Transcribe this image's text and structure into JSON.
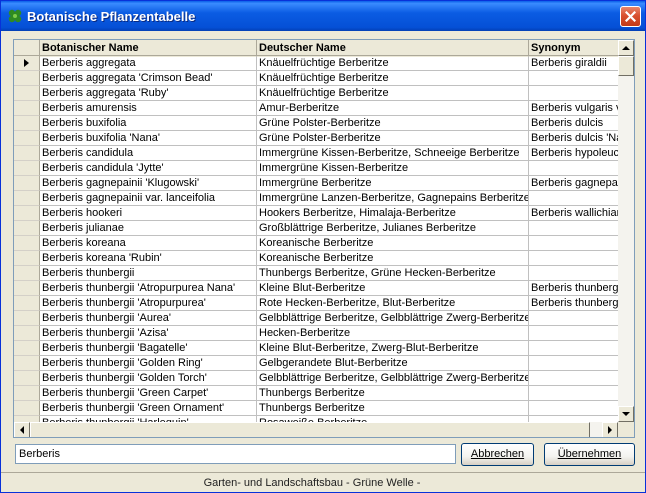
{
  "window": {
    "title": "Botanische Pflanzentabelle"
  },
  "table": {
    "columns": [
      "Botanischer Name",
      "Deutscher Name",
      "Synonym"
    ],
    "rows": [
      [
        "Berberis aggregata",
        "Knäuelfrüchtige Berberitze",
        "Berberis giraldii"
      ],
      [
        "Berberis aggregata 'Crimson Bead'",
        "Knäuelfrüchtige Berberitze",
        ""
      ],
      [
        "Berberis aggregata 'Ruby'",
        "Knäuelfrüchtige Berberitze",
        ""
      ],
      [
        "Berberis amurensis",
        "Amur-Berberitze",
        "Berberis vulgaris v"
      ],
      [
        "Berberis buxifolia",
        "Grüne Polster-Berberitze",
        "Berberis dulcis"
      ],
      [
        "Berberis buxifolia 'Nana'",
        "Grüne Polster-Berberitze",
        "Berberis dulcis 'Na"
      ],
      [
        "Berberis candidula",
        "Immergrüne Kissen-Berberitze, Schneeige Berberitze",
        "Berberis hypoleuca"
      ],
      [
        "Berberis candidula 'Jytte'",
        "Immergrüne Kissen-Berberitze",
        ""
      ],
      [
        "Berberis gagnepainii 'Klugowski'",
        "Immergrüne Berberitze",
        "Berberis gagnepain"
      ],
      [
        "Berberis gagnepainii var. lanceifolia",
        "Immergrüne Lanzen-Berberitze, Gagnepains Berberitze",
        ""
      ],
      [
        "Berberis hookeri",
        "Hookers Berberitze, Himalaja-Berberitze",
        "Berberis wallichian"
      ],
      [
        "Berberis julianae",
        "Großblättrige Berberitze, Julianes Berberitze",
        ""
      ],
      [
        "Berberis koreana",
        "Koreanische Berberitze",
        ""
      ],
      [
        "Berberis koreana 'Rubin'",
        "Koreanische Berberitze",
        ""
      ],
      [
        "Berberis thunbergii",
        "Thunbergs Berberitze, Grüne Hecken-Berberitze",
        ""
      ],
      [
        "Berberis thunbergii 'Atropurpurea Nana'",
        "Kleine Blut-Berberitze",
        "Berberis thunbergii"
      ],
      [
        "Berberis thunbergii 'Atropurpurea'",
        "Rote Hecken-Berberitze, Blut-Berberitze",
        "Berberis thunbergii"
      ],
      [
        "Berberis thunbergii 'Aurea'",
        "Gelbblättrige Berberitze, Gelbblättrige Zwerg-Berberitze",
        ""
      ],
      [
        "Berberis thunbergii 'Azisa'",
        "Hecken-Berberitze",
        ""
      ],
      [
        "Berberis thunbergii 'Bagatelle'",
        "Kleine Blut-Berberitze, Zwerg-Blut-Berberitze",
        ""
      ],
      [
        "Berberis thunbergii 'Golden Ring'",
        "Gelbgerandete Blut-Berberitze",
        ""
      ],
      [
        "Berberis thunbergii 'Golden Torch'",
        "Gelbblättrige Berberitze, Gelbblättrige Zwerg-Berberitze",
        ""
      ],
      [
        "Berberis thunbergii 'Green Carpet'",
        "Thunbergs Berberitze",
        ""
      ],
      [
        "Berberis thunbergii 'Green Ornament'",
        "Thunbergs Berberitze",
        ""
      ],
      [
        "Berberis thunbergii 'Harlequin'",
        "Rosaweiße Berberitze",
        ""
      ]
    ]
  },
  "search": {
    "value": "Berberis"
  },
  "buttons": {
    "cancel": "Abbrechen",
    "accept": "Übernehmen"
  },
  "status": {
    "text": "Garten- und Landschaftsbau   - Grüne Welle -"
  },
  "colors": {
    "title_bar": "#0554de",
    "close_button": "#d9502f",
    "window_bg": "#ece9d8"
  },
  "icons": {
    "app": "clover-icon",
    "close": "close-icon",
    "row_pointer": "row-pointer-icon"
  }
}
